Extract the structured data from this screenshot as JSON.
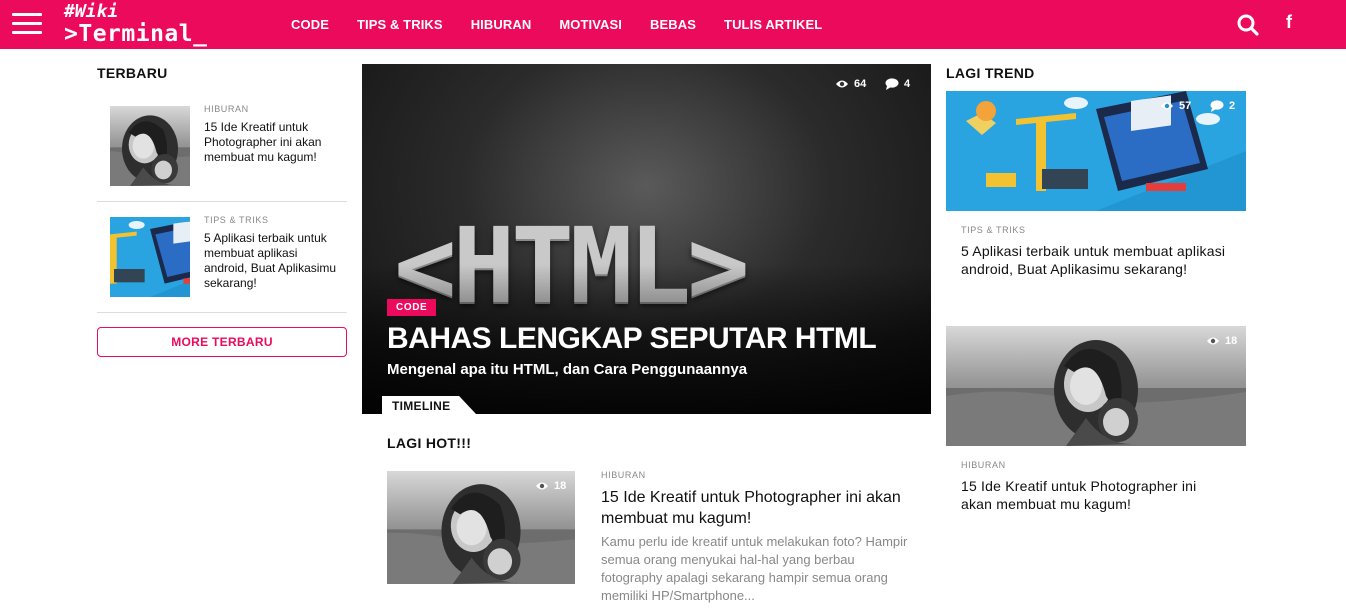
{
  "header": {
    "logo_line1": "#Wiki",
    "logo_line2": ">Terminal_",
    "nav": [
      "CODE",
      "TIPS & TRIKS",
      "HIBURAN",
      "MOTIVASI",
      "BEBAS",
      "TULIS ARTIKEL"
    ],
    "facebook_glyph": "f",
    "accent_color": "#ec0a5c",
    "icons": [
      "menu-icon",
      "search-icon",
      "facebook-icon"
    ]
  },
  "terbaru": {
    "title": "TERBARU",
    "items": [
      {
        "category": "HIBURAN",
        "title": "15 Ide Kreatif untuk Photographer ini akan membuat mu kagum!"
      },
      {
        "category": "TIPS & TRIKS",
        "title": "5 Aplikasi terbaik untuk membuat aplikasi android, Buat Aplikasimu sekarang!"
      }
    ],
    "more_label": "MORE TERBARU"
  },
  "featured": {
    "art_text": "<HTML>",
    "views": "64",
    "comments": "4",
    "category": "CODE",
    "title": "BAHAS LENGKAP SEPUTAR HTML",
    "subtitle": "Mengenal apa itu HTML, dan Cara Penggunaannya",
    "tab_label": "TIMELINE"
  },
  "lagi_hot": {
    "title": "LAGI HOT!!!",
    "post": {
      "views": "18",
      "category": "HIBURAN",
      "title": "15 Ide Kreatif untuk Photographer ini akan membuat mu kagum!",
      "excerpt": "Kamu perlu ide kreatif untuk melakukan foto? Hampir semua orang menyukai hal-hal yang berbau fotography apalagi sekarang hampir semua orang memiliki HP/Smartphone..."
    }
  },
  "lagi_trend": {
    "title": "LAGI TREND",
    "items": [
      {
        "views": "57",
        "comments": "2",
        "category": "TIPS & TRIKS",
        "title": "5 Aplikasi terbaik untuk membuat aplikasi android, Buat Aplikasimu sekarang!"
      },
      {
        "views": "18",
        "category": "HIBURAN",
        "title": "15 Ide Kreatif untuk Photographer ini akan membuat mu kagum!"
      }
    ]
  }
}
